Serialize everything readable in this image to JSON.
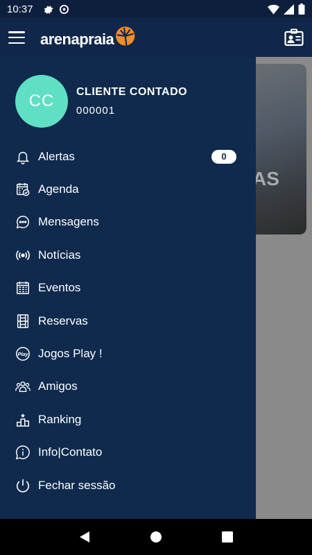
{
  "status_bar": {
    "time": "10:37",
    "left_icons": [
      "gear-icon",
      "at-sign-icon"
    ],
    "right_icons": [
      "wifi-icon",
      "signal-icon",
      "battery-icon"
    ]
  },
  "app_bar": {
    "logo_text": "arenapraia",
    "menu_icon": "hamburger-icon",
    "action_icon": "contact-card-icon"
  },
  "profile": {
    "initials": "CC",
    "name": "CLIENTE CONTADO",
    "id": "000001",
    "avatar_color": "#5fe0c4"
  },
  "menu": [
    {
      "label": "Alertas",
      "icon": "bell-icon",
      "badge": "0"
    },
    {
      "label": "Agenda",
      "icon": "calendar-check-icon"
    },
    {
      "label": "Mensagens",
      "icon": "chat-bubble-icon"
    },
    {
      "label": "Notícias",
      "icon": "broadcast-icon"
    },
    {
      "label": "Eventos",
      "icon": "calendar-grid-icon"
    },
    {
      "label": "Reservas",
      "icon": "court-icon"
    },
    {
      "label": "Jogos Play !",
      "icon": "play-badge-icon"
    },
    {
      "label": "Amigos",
      "icon": "people-icon"
    },
    {
      "label": "Ranking",
      "icon": "podium-icon"
    },
    {
      "label": "Info|Contato",
      "icon": "info-icon"
    },
    {
      "label": "Fechar sessão",
      "icon": "power-icon"
    }
  ],
  "play_icon_text": "Play",
  "background_card_letters": "AS",
  "colors": {
    "drawer": "#0f2a4d",
    "app_bar": "#10264a",
    "accent_orange": "#f28c28"
  },
  "nav_bar": [
    "back-icon",
    "home-icon",
    "recents-icon"
  ]
}
